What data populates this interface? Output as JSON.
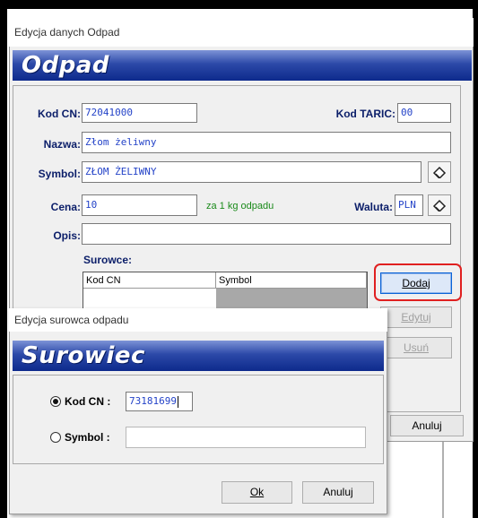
{
  "odpad": {
    "window_title": "Edycja danych Odpad",
    "banner": "Odpad",
    "labels": {
      "kod_cn": "Kod CN:",
      "kod_taric": "Kod TARIC:",
      "nazwa": "Nazwa:",
      "symbol": "Symbol:",
      "cena": "Cena:",
      "waluta": "Waluta:",
      "opis": "Opis:",
      "surowce": "Surowce:"
    },
    "values": {
      "kod_cn": "72041000",
      "kod_taric": "00",
      "nazwa": "Złom żeliwny",
      "symbol": "ZŁOM ŻELIWNY",
      "cena": "10",
      "waluta": "PLN",
      "opis": ""
    },
    "cena_unit": "za 1 kg odpadu",
    "grid_columns": [
      "Kod CN",
      "Symbol"
    ],
    "buttons": {
      "dodaj": "Dodaj",
      "edytuj": "Edytuj",
      "usun": "Usuń",
      "anuluj": "Anuluj"
    }
  },
  "surowiec": {
    "window_title": "Edycja surowca odpadu",
    "banner": "Surowiec",
    "kod_cn_label": "Kod CN :",
    "kod_cn_value": "73181699",
    "symbol_label": "Symbol :",
    "symbol_value": "",
    "selected_option": "kod_cn",
    "buttons": {
      "ok": "Ok",
      "anuluj": "Anuluj"
    }
  },
  "colors": {
    "label": "#0b1e69",
    "field_text": "#2443c8",
    "banner_top": "#7d93d6",
    "banner_bottom": "#0d2a8c",
    "highlight": "#e02020",
    "unit_text": "#1a8a1a"
  }
}
